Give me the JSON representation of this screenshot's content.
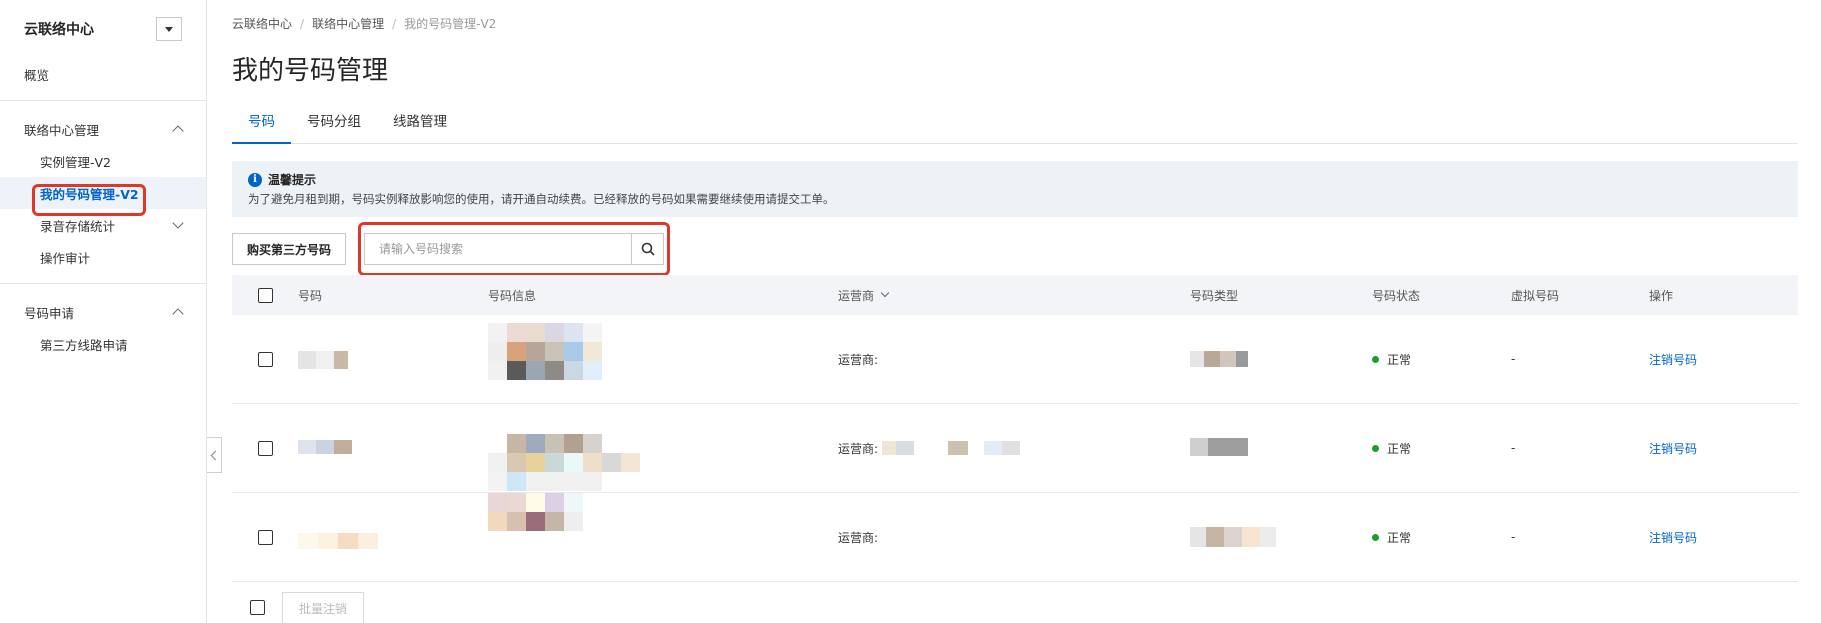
{
  "sidebar": {
    "title": "云联络中心",
    "overview": "概览",
    "groups": [
      {
        "label": "联络中心管理",
        "items": [
          "实例管理-V2",
          "我的号码管理-V2",
          "录音存储统计",
          "操作审计"
        ]
      },
      {
        "label": "号码申请",
        "items": [
          "第三方线路申请"
        ]
      }
    ]
  },
  "breadcrumb": [
    "云联络中心",
    "联络中心管理",
    "我的号码管理-V2"
  ],
  "page_title": "我的号码管理",
  "tabs": [
    "号码",
    "号码分组",
    "线路管理"
  ],
  "notice": {
    "title": "温馨提示",
    "text": "为了避免月租到期，号码实例释放影响您的使用，请开通自动续费。已经释放的号码如果需要继续使用请提交工单。"
  },
  "toolbar": {
    "buy_label": "购买第三方号码",
    "search_placeholder": "请输入号码搜索"
  },
  "table": {
    "headers": [
      "号码",
      "号码信息",
      "运营商",
      "号码类型",
      "号码状态",
      "虚拟号码",
      "操作"
    ],
    "rows": [
      {
        "carrier": "运营商:",
        "status": "正常",
        "virtual": "-",
        "action": "注销号码"
      },
      {
        "carrier": "运营商:",
        "status": "正常",
        "virtual": "-",
        "action": "注销号码"
      },
      {
        "carrier": "运营商:",
        "status": "正常",
        "virtual": "-",
        "action": "注销号码"
      }
    ]
  },
  "footer": {
    "batch_label": "批量注销"
  },
  "colors": {
    "accent": "#0064c8",
    "highlight": "#e0372b",
    "status_ok": "#18a02a"
  }
}
